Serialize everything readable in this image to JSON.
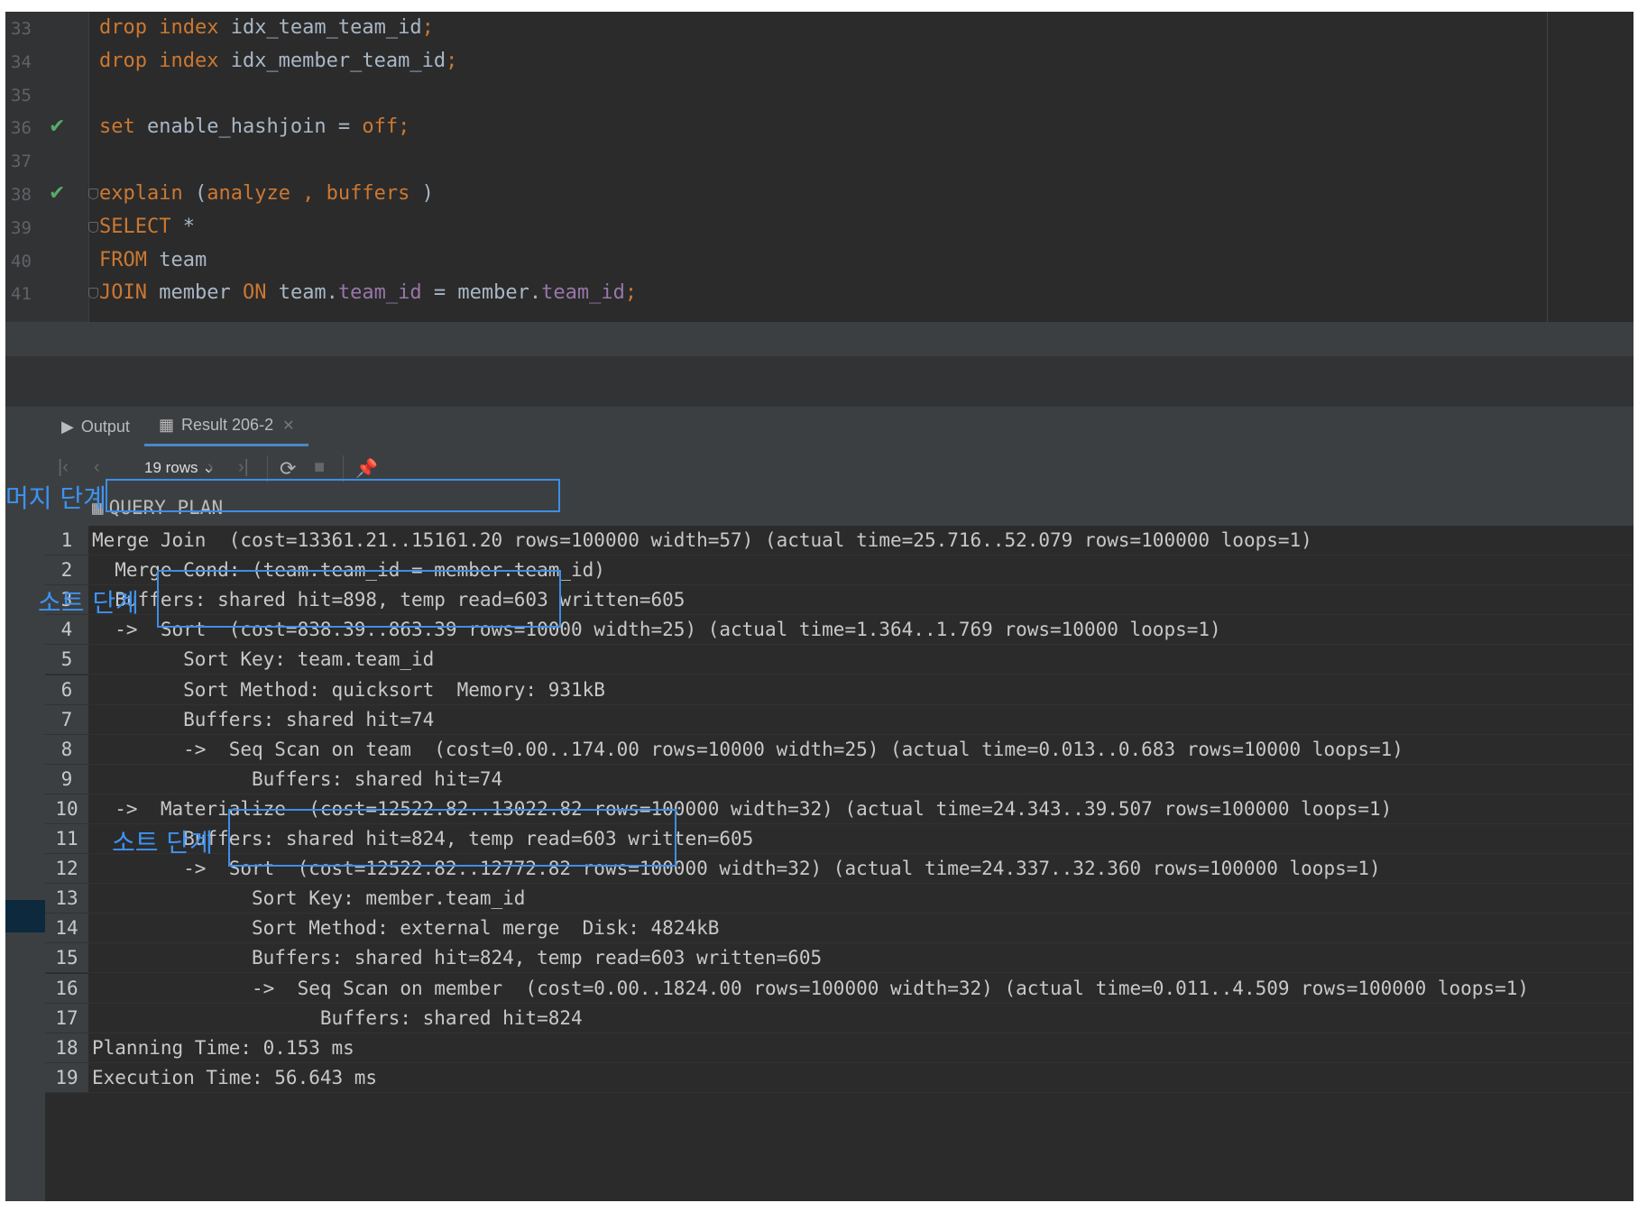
{
  "editor": {
    "lines": [
      {
        "num": "33",
        "check": false,
        "fold": false,
        "tokens": [
          {
            "t": "drop index",
            "c": "kw"
          },
          {
            "t": " idx_team_team_id",
            "c": "id"
          },
          {
            "t": ";",
            "c": "kw"
          }
        ]
      },
      {
        "num": "34",
        "check": false,
        "fold": false,
        "tokens": [
          {
            "t": "drop index",
            "c": "kw"
          },
          {
            "t": " idx_member_team_id",
            "c": "id"
          },
          {
            "t": ";",
            "c": "kw"
          }
        ]
      },
      {
        "num": "35",
        "check": false,
        "fold": false,
        "tokens": []
      },
      {
        "num": "36",
        "check": true,
        "fold": false,
        "tokens": [
          {
            "t": "set",
            "c": "kw"
          },
          {
            "t": " enable_hashjoin = ",
            "c": "id"
          },
          {
            "t": "off;",
            "c": "kw"
          }
        ]
      },
      {
        "num": "37",
        "check": false,
        "fold": false,
        "tokens": []
      },
      {
        "num": "38",
        "check": true,
        "fold": true,
        "tokens": [
          {
            "t": "explain",
            "c": "kw"
          },
          {
            "t": " (",
            "c": "id"
          },
          {
            "t": "analyze , buffers",
            "c": "kw"
          },
          {
            "t": " )",
            "c": "id"
          }
        ]
      },
      {
        "num": "39",
        "check": false,
        "fold": true,
        "tokens": [
          {
            "t": "SELECT",
            "c": "kw"
          },
          {
            "t": " *",
            "c": "id"
          }
        ]
      },
      {
        "num": "40",
        "check": false,
        "fold": false,
        "tokens": [
          {
            "t": "FROM",
            "c": "kw"
          },
          {
            "t": " team",
            "c": "id"
          }
        ]
      },
      {
        "num": "41",
        "check": false,
        "fold": true,
        "tokens": [
          {
            "t": "JOIN",
            "c": "kw"
          },
          {
            "t": " member ",
            "c": "id"
          },
          {
            "t": "ON",
            "c": "kw"
          },
          {
            "t": " team.",
            "c": "id"
          },
          {
            "t": "team_id",
            "c": "fld"
          },
          {
            "t": " = member.",
            "c": "id"
          },
          {
            "t": "team_id",
            "c": "fld"
          },
          {
            "t": ";",
            "c": "kw"
          }
        ]
      }
    ],
    "check_icon": "checkmark-icon"
  },
  "tabs": {
    "output_label": "Output",
    "output_icon": "console-output-icon",
    "result_label": "Result 206-2",
    "result_icon": "table-icon",
    "close_icon": "close-icon"
  },
  "toolbar": {
    "rows_label": "19 rows",
    "icons": [
      "first-page-icon",
      "previous-page-icon",
      "next-page-icon",
      "last-page-icon",
      "refresh-icon",
      "stop-icon",
      "pin-icon"
    ]
  },
  "grid": {
    "column": "QUERY PLAN",
    "rows": [
      {
        "n": "1",
        "text": "Merge Join  (cost=13361.21..15161.20 rows=100000 width=57) (actual time=25.716..52.079 rows=100000 loops=1)"
      },
      {
        "n": "2",
        "text": "  Merge Cond: (team.team_id = member.team_id)"
      },
      {
        "n": "3",
        "text": "  Buffers: shared hit=898, temp read=603 written=605"
      },
      {
        "n": "4",
        "text": "  ->  Sort  (cost=838.39..863.39 rows=10000 width=25) (actual time=1.364..1.769 rows=10000 loops=1)"
      },
      {
        "n": "5",
        "text": "        Sort Key: team.team_id"
      },
      {
        "n": "6",
        "text": "        Sort Method: quicksort  Memory: 931kB"
      },
      {
        "n": "7",
        "text": "        Buffers: shared hit=74"
      },
      {
        "n": "8",
        "text": "        ->  Seq Scan on team  (cost=0.00..174.00 rows=10000 width=25) (actual time=0.013..0.683 rows=10000 loops=1)"
      },
      {
        "n": "9",
        "text": "              Buffers: shared hit=74"
      },
      {
        "n": "10",
        "text": "  ->  Materialize  (cost=12522.82..13022.82 rows=100000 width=32) (actual time=24.343..39.507 rows=100000 loops=1)"
      },
      {
        "n": "11",
        "text": "        Buffers: shared hit=824, temp read=603 written=605"
      },
      {
        "n": "12",
        "text": "        ->  Sort  (cost=12522.82..12772.82 rows=100000 width=32) (actual time=24.337..32.360 rows=100000 loops=1)"
      },
      {
        "n": "13",
        "text": "              Sort Key: member.team_id"
      },
      {
        "n": "14",
        "text": "              Sort Method: external merge  Disk: 4824kB"
      },
      {
        "n": "15",
        "text": "              Buffers: shared hit=824, temp read=603 written=605"
      },
      {
        "n": "16",
        "text": "              ->  Seq Scan on member  (cost=0.00..1824.00 rows=100000 width=32) (actual time=0.011..4.509 rows=100000 loops=1)"
      },
      {
        "n": "17",
        "text": "                    Buffers: shared hit=824"
      },
      {
        "n": "18",
        "text": "Planning Time: 0.153 ms"
      },
      {
        "n": "19",
        "text": "Execution Time: 56.643 ms"
      }
    ]
  },
  "annotations": {
    "merge_stage": "머지 단계",
    "sort_stage_1": "소트 단계",
    "sort_stage_2": "소트 단계"
  },
  "colors": {
    "keyword": "#cc7832",
    "field": "#9876aa",
    "identifier": "#a9b7c6",
    "annotation": "#3d8ee6",
    "check": "#59a869"
  }
}
